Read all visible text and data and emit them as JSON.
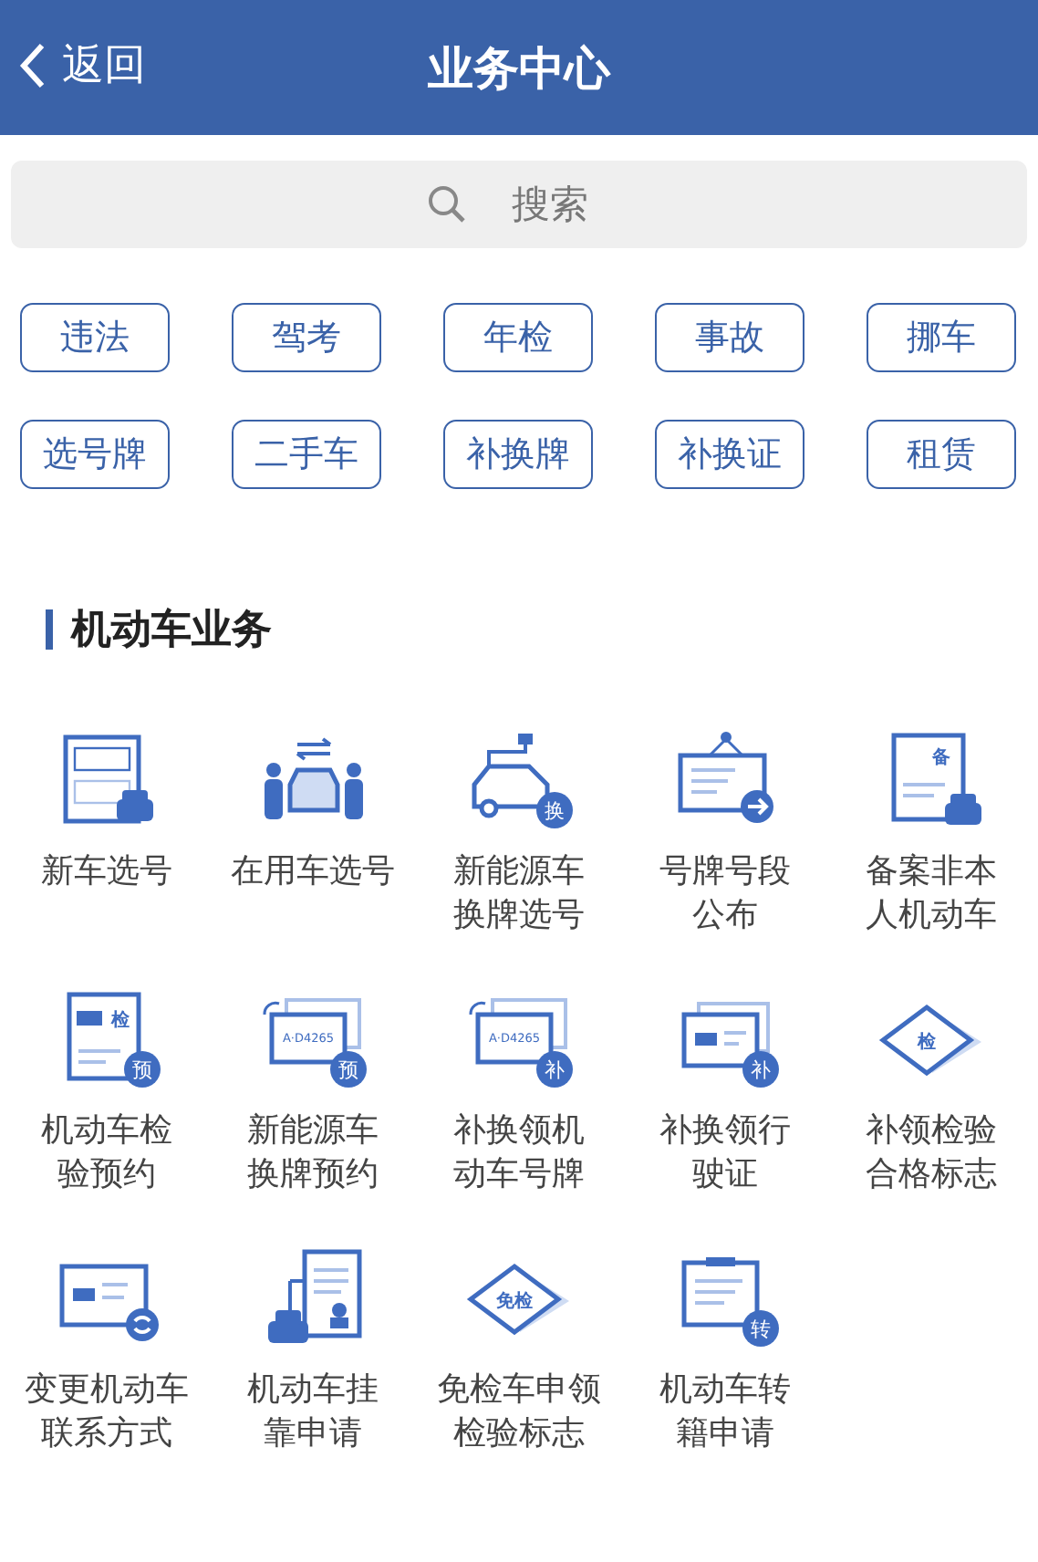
{
  "header": {
    "back": "返回",
    "title": "业务中心"
  },
  "search": {
    "placeholder": "搜索"
  },
  "tags": [
    "违法",
    "驾考",
    "年检",
    "事故",
    "挪车",
    "选号牌",
    "二手车",
    "补换牌",
    "补换证",
    "租赁"
  ],
  "section": {
    "title": "机动车业务",
    "services": [
      {
        "kind": "plate-form",
        "lines": [
          "新车选号"
        ]
      },
      {
        "kind": "swap-people",
        "lines": [
          "在用车选号"
        ]
      },
      {
        "kind": "ev-car",
        "badge": "换",
        "lines": [
          "新能源车",
          "换牌选号"
        ]
      },
      {
        "kind": "notice-board",
        "lines": [
          "号牌号段",
          "公布"
        ]
      },
      {
        "kind": "record-doc",
        "badge": "备",
        "lines": [
          "备案非本",
          "人机动车"
        ]
      },
      {
        "kind": "inspect-doc",
        "badge": "预",
        "stamp": "检",
        "lines": [
          "机动车检",
          "验预约"
        ]
      },
      {
        "kind": "plate-pair",
        "badge": "预",
        "plate": "A·D4265",
        "lines": [
          "新能源车",
          "换牌预约"
        ]
      },
      {
        "kind": "plate-pair",
        "badge": "补",
        "plate": "A·D4265",
        "lines": [
          "补换领机",
          "动车号牌"
        ]
      },
      {
        "kind": "license-card",
        "badge": "补",
        "lines": [
          "补换领行",
          "驶证"
        ]
      },
      {
        "kind": "diamond",
        "stamp": "检",
        "lines": [
          "补领检验",
          "合格标志"
        ]
      },
      {
        "kind": "change-card",
        "lines": [
          "变更机动车",
          "联系方式"
        ]
      },
      {
        "kind": "tow-doc",
        "lines": [
          "机动车挂",
          "靠申请"
        ]
      },
      {
        "kind": "diamond",
        "stamp": "免检",
        "lines": [
          "免检车申领",
          "检验标志"
        ]
      },
      {
        "kind": "transfer-doc",
        "badge": "转",
        "lines": [
          "机动车转",
          "籍申请"
        ]
      }
    ]
  }
}
